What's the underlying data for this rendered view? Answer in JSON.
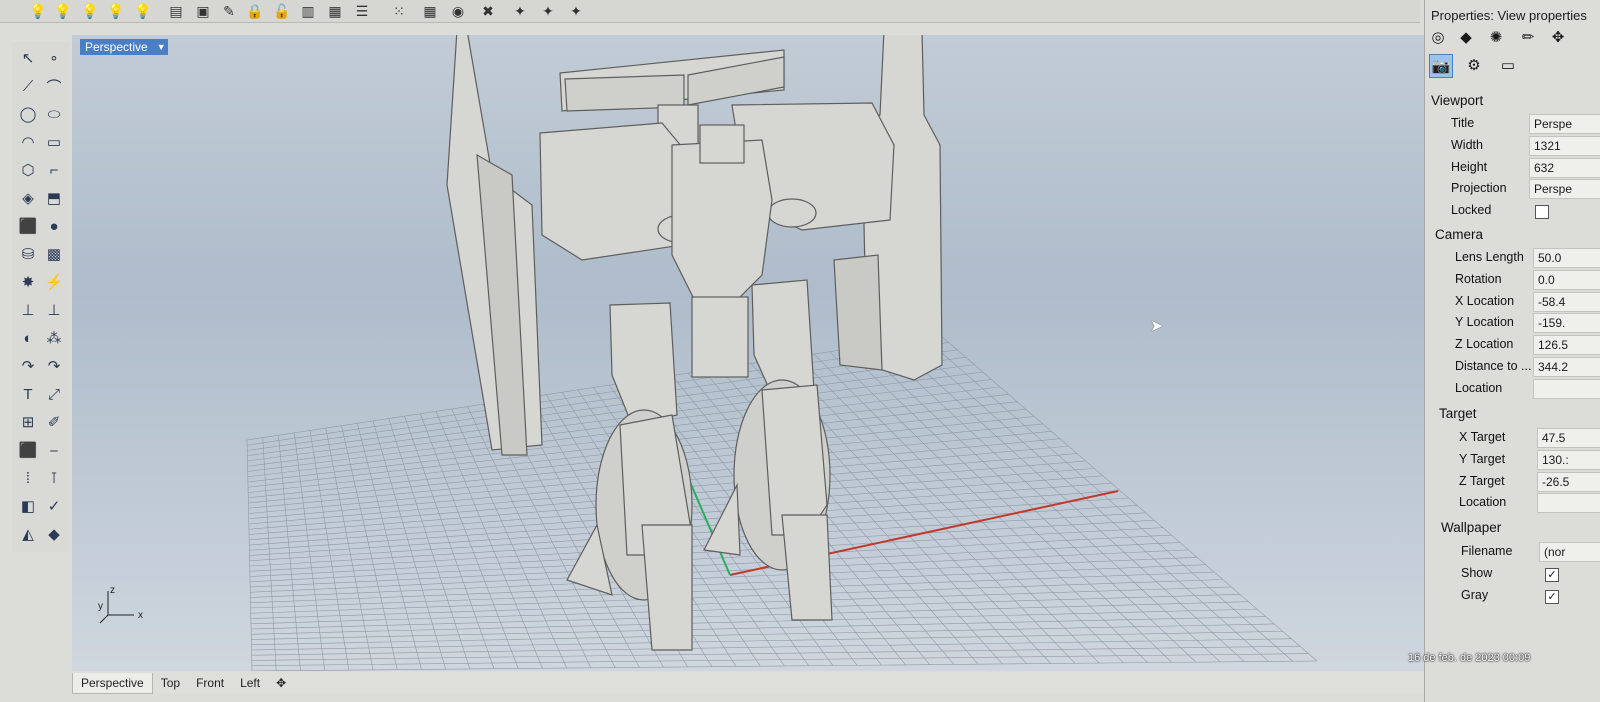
{
  "toolbar": {
    "top_icons": [
      "bulb-off-icon",
      "bulb-on-icon",
      "bulb-on-icon",
      "bulb-arrow-icon",
      "bulbs-icon",
      "page-lock-icon",
      "lightbulb-page-icon",
      "pencil-page-icon",
      "lock-icon",
      "lock-open-icon",
      "layer-edit-icon",
      "layer-new-icon",
      "layer-list-icon",
      "grid-points-icon",
      "grid-small-icon",
      "snap-icon",
      "globe-blue-icon",
      "globe-red-icon",
      "bulb-cluster-icon",
      "bulb-cluster-icon",
      "bulb-cluster-icon"
    ]
  },
  "left_toolbar": {
    "icons": [
      "arrow-select-icon",
      "point-icon",
      "polyline-icon",
      "curve-points-icon",
      "circle-icon",
      "ellipse-icon",
      "arc-icon",
      "rectangle-icon",
      "polygon-icon",
      "fillet-icon",
      "surface-icon",
      "extrude-icon",
      "box-icon",
      "sphere-icon",
      "cylinder-icon",
      "mesh-icon",
      "explode-icon",
      "trim-icon",
      "split-icon",
      "join-icon",
      "boolean-icon",
      "group-icon",
      "rotate-icon",
      "scale-icon",
      "text-icon",
      "dimension-icon",
      "array-icon",
      "transform-icon",
      "block-icon",
      "layer-icon",
      "grid-array-icon",
      "align-icon",
      "analyze-icon",
      "check-icon",
      "render-icon",
      "material-icon"
    ]
  },
  "viewport": {
    "label": "Perspective"
  },
  "tabs": [
    "Perspective",
    "Top",
    "Front",
    "Left"
  ],
  "properties": {
    "title": "Properties: View properties",
    "sections": {
      "viewport": "Viewport",
      "camera": "Camera",
      "target": "Target",
      "wallpaper": "Wallpaper"
    },
    "viewport_rows": [
      {
        "label": "Title",
        "value": "Perspe"
      },
      {
        "label": "Width",
        "value": "1321"
      },
      {
        "label": "Height",
        "value": "632"
      },
      {
        "label": "Projection",
        "value": "Perspe"
      },
      {
        "label": "Locked",
        "value": ""
      }
    ],
    "camera_rows": [
      {
        "label": "Lens Length",
        "value": "50.0"
      },
      {
        "label": "Rotation",
        "value": "0.0"
      },
      {
        "label": "X Location",
        "value": "-58.4"
      },
      {
        "label": "Y Location",
        "value": "-159."
      },
      {
        "label": "Z Location",
        "value": "126.5"
      },
      {
        "label": "Distance to ...",
        "value": "344.2"
      },
      {
        "label": "Location",
        "value": ""
      }
    ],
    "target_rows": [
      {
        "label": "X Target",
        "value": "47.5"
      },
      {
        "label": "Y Target",
        "value": "130.:"
      },
      {
        "label": "Z Target",
        "value": "-26.5"
      },
      {
        "label": "Location",
        "value": ""
      }
    ],
    "wallpaper_rows": [
      {
        "label": "Filename",
        "value": "(nor"
      },
      {
        "label": "Show",
        "value": "✓"
      },
      {
        "label": "Gray",
        "value": "✓"
      }
    ]
  },
  "timestamp": "16 de feb. de 2023 00:09",
  "axis_labels": {
    "x": "x",
    "y": "y",
    "z": "z"
  },
  "colors": {
    "accent": "#4a7fc6",
    "x_axis": "#c0392b",
    "y_axis": "#27ae60",
    "model": "#d6d6d3"
  }
}
